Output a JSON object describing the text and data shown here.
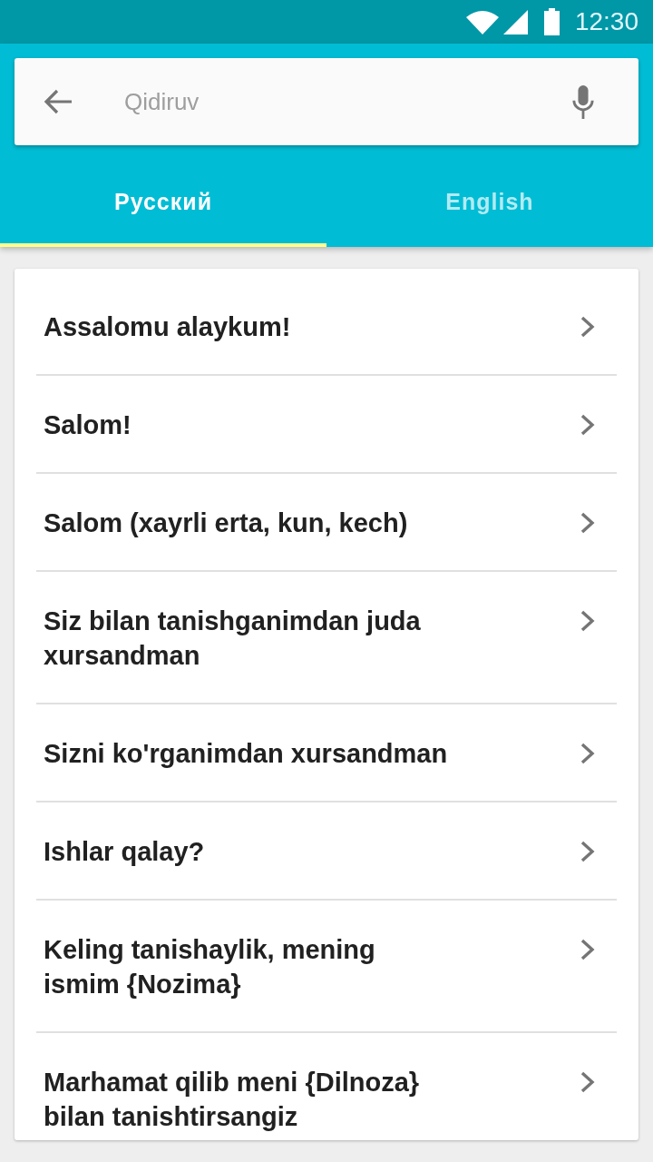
{
  "status_bar": {
    "time": "12:30"
  },
  "search": {
    "placeholder": "Qidiruv"
  },
  "tabs": [
    {
      "label": "Русский",
      "selected": true
    },
    {
      "label": "English",
      "selected": false
    }
  ],
  "phrases": [
    {
      "text": "Assalomu alaykum!"
    },
    {
      "text": "Salom!"
    },
    {
      "text": "Salom (xayrli erta, kun, kech)"
    },
    {
      "text": "Siz bilan tanishganimdan juda xursandman"
    },
    {
      "text": "Sizni ko'rganimdan xursandman"
    },
    {
      "text": "Ishlar qalay?"
    },
    {
      "text": "Keling tanishaylik, mening ismim {Nozima}"
    },
    {
      "text": "Marhamat qilib meni {Dilnoza} bilan tanishtirsangiz"
    }
  ]
}
